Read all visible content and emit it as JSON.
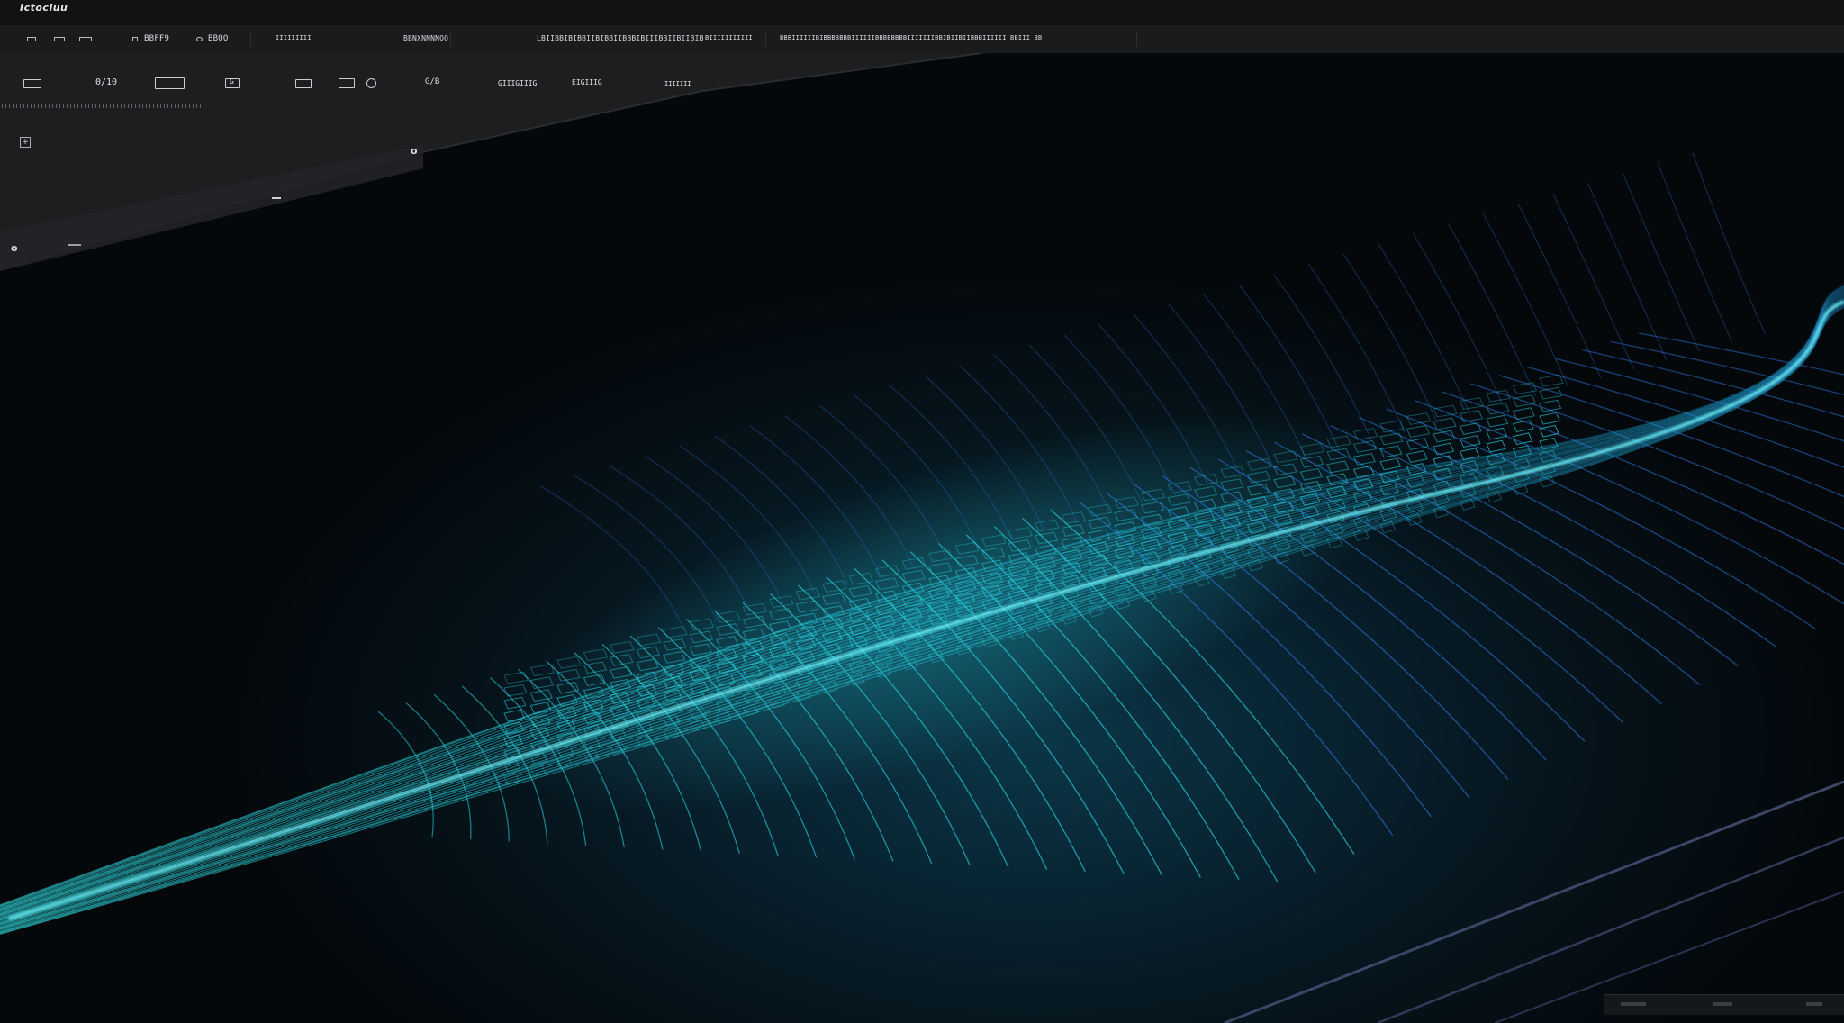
{
  "window": {
    "title": "Ictocluu"
  },
  "menubar": {
    "items": [
      {
        "label": "BBFF9"
      },
      {
        "label": "BBOO"
      },
      {
        "label": "IIIIIIIII"
      },
      {
        "label": "BBNXNNNNOO"
      },
      {
        "label": "LBIIBBIBIBBIIBIBBIIBBBIBIIIBBIIBIIBIB"
      },
      {
        "label": "BIIIIIIIIIII"
      },
      {
        "label": "BBBIIIIIIBIBBBBBBBIIIIIIBBBBBBBBIIIIIIIBBIBIIBIIBBBIIIIII BBIII BB"
      }
    ]
  },
  "toolbar": {
    "counter_label": "0/10",
    "shape_label": "G",
    "mode_label": "G/B",
    "option_a": "GIIIGIIIG",
    "option_b": "EIGIIIG",
    "option_c": "IIIIIII",
    "add_symbol": "+",
    "knob_symbol": "o"
  },
  "viewport": {
    "accent_color": "#27d3e0",
    "secondary_color": "#2a74d6",
    "guide_color": "#3f4a6b"
  }
}
